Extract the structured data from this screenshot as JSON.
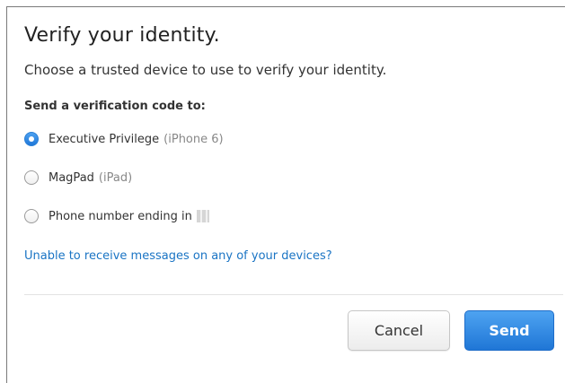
{
  "dialog": {
    "title": "Verify your identity.",
    "subtitle": "Choose a trusted device to use to verify your identity.",
    "section_label": "Send a verification code to:",
    "options": [
      {
        "label": "Executive Privilege",
        "detail": "(iPhone 6)",
        "selected": true
      },
      {
        "label": "MagPad",
        "detail": "(iPad)",
        "selected": false
      },
      {
        "label": "Phone number ending in",
        "detail": "",
        "selected": false
      }
    ],
    "help_link": "Unable to receive messages on any of your devices?",
    "buttons": {
      "cancel_label": "Cancel",
      "send_label": "Send"
    }
  },
  "colors": {
    "accent": "#1f78d9",
    "link": "#1a74c4"
  }
}
